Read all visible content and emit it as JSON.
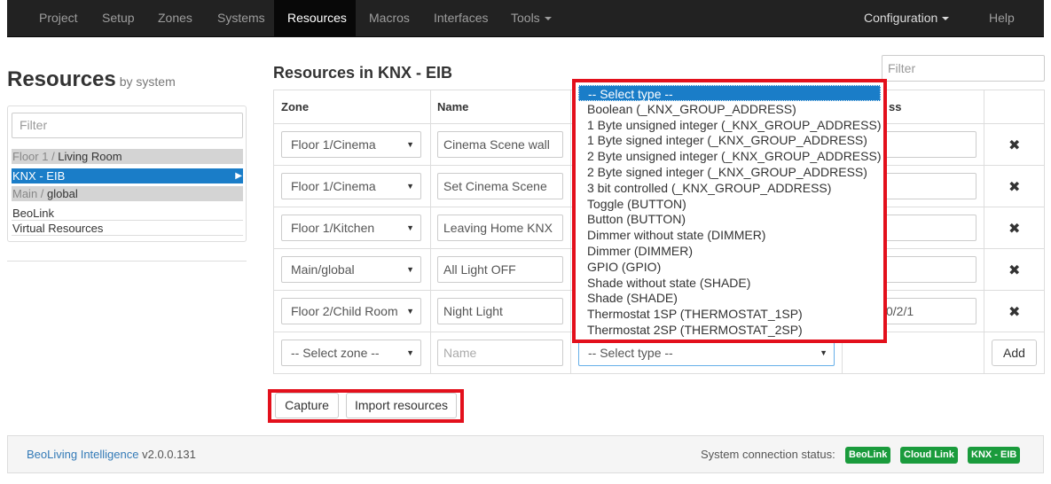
{
  "navbar": {
    "items": [
      "Project",
      "Setup",
      "Zones",
      "Systems",
      "Resources",
      "Macros",
      "Interfaces",
      "Tools"
    ],
    "active": "Resources",
    "configuration": "Configuration",
    "help": "Help"
  },
  "sidebar": {
    "title": "Resources",
    "subtitle": "by system",
    "filter_placeholder": "Filter",
    "tree": [
      {
        "prefix": "Floor 1 / ",
        "label": "Living Room",
        "state": "group"
      },
      {
        "prefix": "",
        "label": "KNX - EIB",
        "state": "selected"
      },
      {
        "prefix": "Main / ",
        "label": "global",
        "state": "group"
      },
      {
        "prefix": "",
        "label": "BeoLink",
        "state": "item"
      },
      {
        "prefix": "",
        "label": "Virtual Resources",
        "state": "item"
      }
    ]
  },
  "main": {
    "title": "Resources in KNX - EIB",
    "filter_placeholder": "Filter",
    "columns": {
      "zone": "Zone",
      "name": "Name",
      "address": "ss"
    },
    "rows": [
      {
        "zone": "Floor 1/Cinema",
        "name": "Cinema Scene wall",
        "address": ""
      },
      {
        "zone": "Floor 1/Cinema",
        "name": "Set Cinema Scene",
        "address": ""
      },
      {
        "zone": "Floor 1/Kitchen",
        "name": "Leaving Home KNX",
        "address": ""
      },
      {
        "zone": "Main/global",
        "name": "All Light OFF",
        "address": ""
      },
      {
        "zone": "Floor 2/Child Room",
        "name": "Night Light",
        "address": "0/2/1"
      }
    ],
    "new_row": {
      "zone_placeholder": "-- Select zone --",
      "name_placeholder": "Name",
      "type_placeholder": "-- Select type --",
      "add_label": "Add"
    },
    "delete_glyph": "✖",
    "capture_label": "Capture",
    "import_label": "Import resources"
  },
  "type_dropdown": {
    "options": [
      "-- Select type --",
      "Boolean (_KNX_GROUP_ADDRESS)",
      "1 Byte unsigned integer (_KNX_GROUP_ADDRESS)",
      "1 Byte signed integer (_KNX_GROUP_ADDRESS)",
      "2 Byte unsigned integer (_KNX_GROUP_ADDRESS)",
      "2 Byte signed integer (_KNX_GROUP_ADDRESS)",
      "3 bit controlled (_KNX_GROUP_ADDRESS)",
      "Toggle (BUTTON)",
      "Button (BUTTON)",
      "Dimmer without state (DIMMER)",
      "Dimmer (DIMMER)",
      "GPIO (GPIO)",
      "Shade without state (SHADE)",
      "Shade (SHADE)",
      "Thermostat 1SP (THERMOSTAT_1SP)",
      "Thermostat 2SP (THERMOSTAT_2SP)"
    ],
    "highlighted_index": 0
  },
  "footer": {
    "app_name": "BeoLiving Intelligence",
    "version": "v2.0.0.131",
    "status_label": "System connection status:",
    "badges": [
      "BeoLink",
      "Cloud Link",
      "KNX - EIB"
    ]
  },
  "colors": {
    "navbar_bg": "#222222",
    "selection_blue": "#1a7dc8",
    "highlight_red": "#e3101c",
    "badge_green": "#1a9b3c"
  }
}
